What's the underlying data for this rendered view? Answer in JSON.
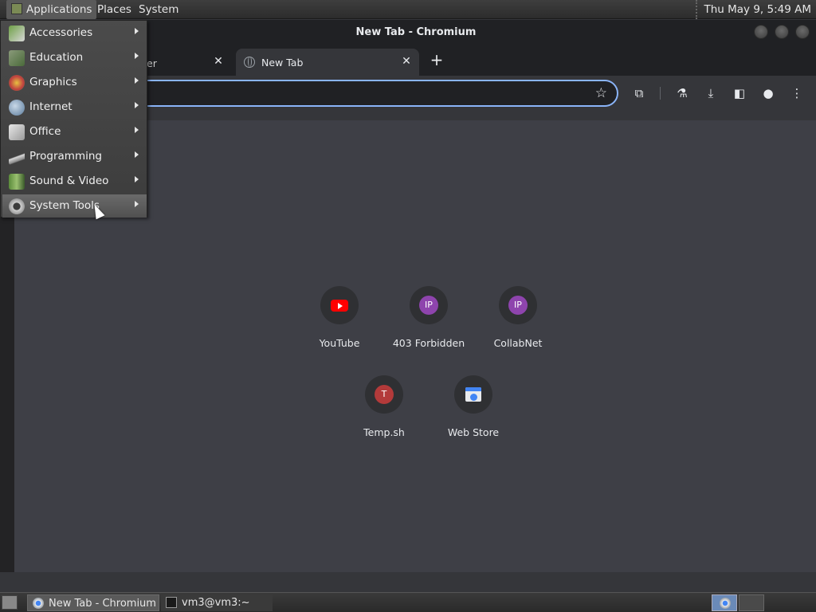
{
  "top_panel": {
    "applications": "Applications",
    "places": "Places",
    "system": "System",
    "clock": "Thu May  9,  5:49 AM"
  },
  "window": {
    "title": "New Tab - Chromium"
  },
  "tabs": [
    {
      "label": "er"
    },
    {
      "label": "New Tab"
    }
  ],
  "omnibox": {
    "value": ""
  },
  "shortcuts": [
    {
      "label": "YouTube",
      "icon": "youtube-icon"
    },
    {
      "label": "403 Forbidden",
      "icon": "IP"
    },
    {
      "label": "CollabNet",
      "icon": "IP"
    },
    {
      "label": "Temp.sh",
      "icon": "T"
    },
    {
      "label": "Web Store",
      "icon": "webstore-icon"
    }
  ],
  "apps_menu": {
    "items": [
      {
        "label": "Accessories"
      },
      {
        "label": "Education"
      },
      {
        "label": "Graphics"
      },
      {
        "label": "Internet"
      },
      {
        "label": "Office"
      },
      {
        "label": "Programming"
      },
      {
        "label": "Sound & Video"
      },
      {
        "label": "System Tools"
      }
    ],
    "highlighted": "System Tools"
  },
  "taskbar": {
    "items": [
      {
        "label": "New Tab - Chromium"
      },
      {
        "label": "vm3@vm3:~"
      }
    ]
  },
  "colors": {
    "accent": "#8ab4f8",
    "background": "#35363a",
    "page": "#3e3f46",
    "ip_badge": "#8e44ad",
    "t_badge": "#b33a3a"
  }
}
